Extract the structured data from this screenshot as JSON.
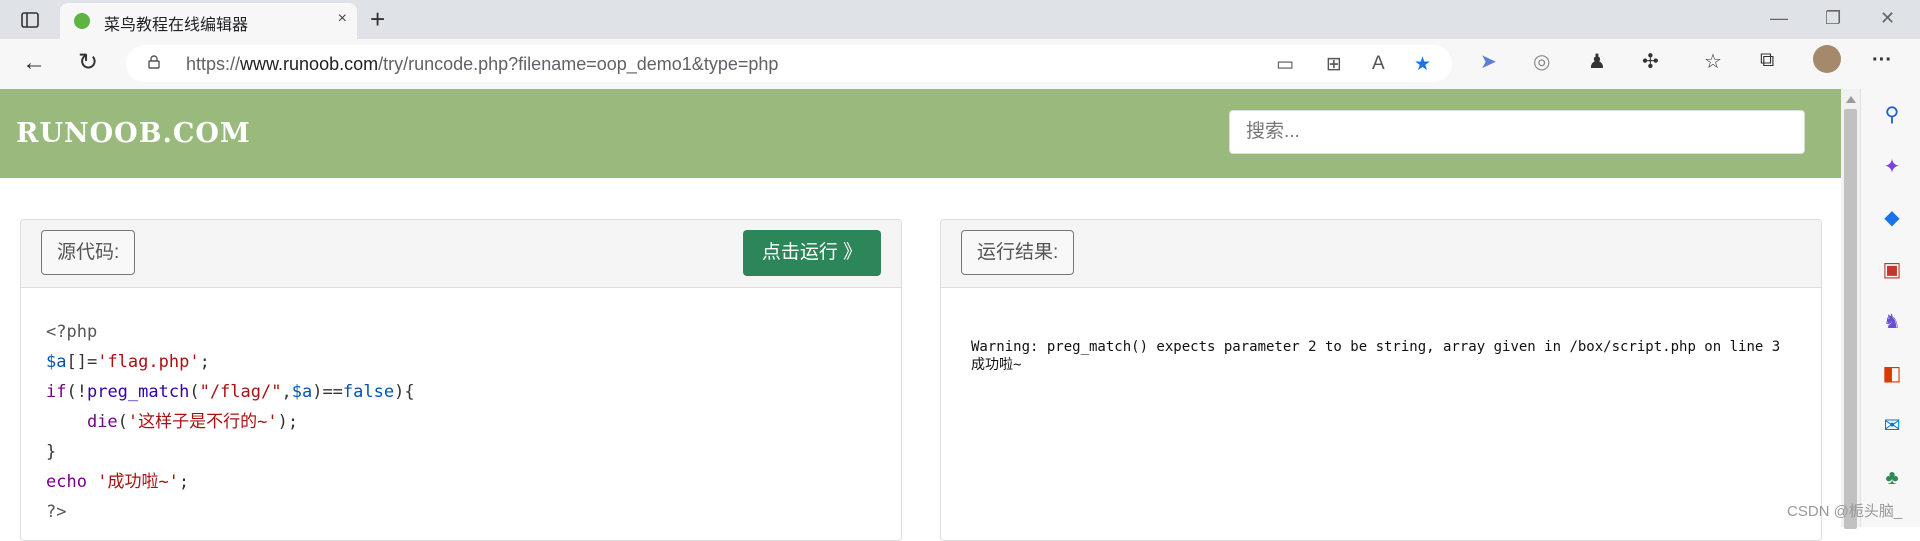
{
  "browser": {
    "tab_title": "菜鸟教程在线编辑器",
    "tab_close": "×",
    "new_tab": "+",
    "window_controls": [
      "—",
      "❐",
      "✕"
    ],
    "url_prefix": "https://",
    "url_host": "www.runoob.com",
    "url_path": "/try/runcode.php?filename=oop_demo1&type=php",
    "back": "←",
    "reload": "↻",
    "more": "···"
  },
  "site": {
    "logo": "RUNOOB.COM",
    "search_placeholder": "搜索..."
  },
  "editor": {
    "source_label": "源代码:",
    "run_label": "点击运行 》",
    "code": {
      "l1": "<?php",
      "l2_var": "$a",
      "l2_op": "[]=",
      "l2_str": "'flag.php'",
      "l2_end": ";",
      "l3_kw": "if",
      "l3_a": "(!",
      "l3_fn": "preg_match",
      "l3_b": "(",
      "l3_str": "\"/flag/\"",
      "l3_c": ",",
      "l3_var": "$a",
      "l3_d": ")==",
      "l3_false": "false",
      "l3_e": "){",
      "l4_fn": "die",
      "l4_a": "(",
      "l4_str": "'这样子是不行的~'",
      "l4_b": ");",
      "l5": "}",
      "l6_kw": "echo",
      "l6_str": "'成功啦~'",
      "l6_end": ";",
      "l7": "?>"
    }
  },
  "result": {
    "label": "运行结果:",
    "line1": "Warning: preg_match() expects parameter 2 to be string, array given in /box/script.php on line 3",
    "line2": "成功啦~"
  },
  "watermark": "CSDN @栀头脑_",
  "colors": {
    "header_bg": "#99b97d",
    "run_button": "#2d8659"
  }
}
